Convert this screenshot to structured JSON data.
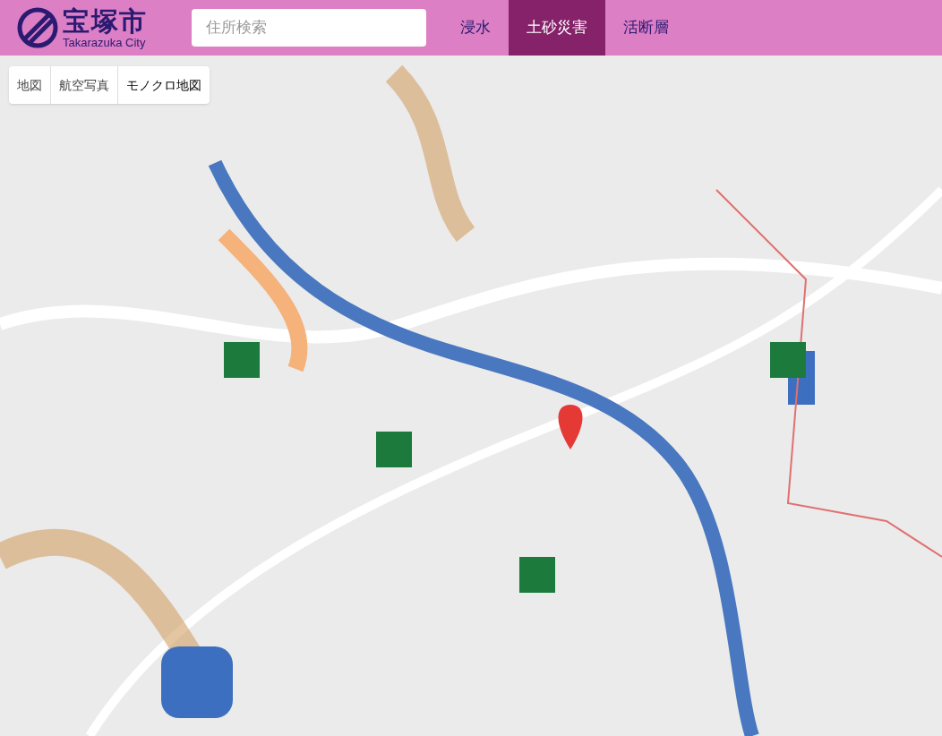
{
  "header": {
    "logo": {
      "name": "宝塚市",
      "subtitle": "Takarazuka City"
    },
    "search": {
      "placeholder": "住所検索"
    },
    "tabs": [
      {
        "label": "浸水",
        "selected": false
      },
      {
        "label": "土砂災害",
        "selected": true
      },
      {
        "label": "活断層",
        "selected": false
      }
    ]
  },
  "map": {
    "kind": "picture",
    "base_layers": [
      {
        "label": "地図",
        "selected": false
      },
      {
        "label": "航空写真",
        "selected": false
      },
      {
        "label": "モノクロ地図",
        "selected": true
      }
    ]
  }
}
